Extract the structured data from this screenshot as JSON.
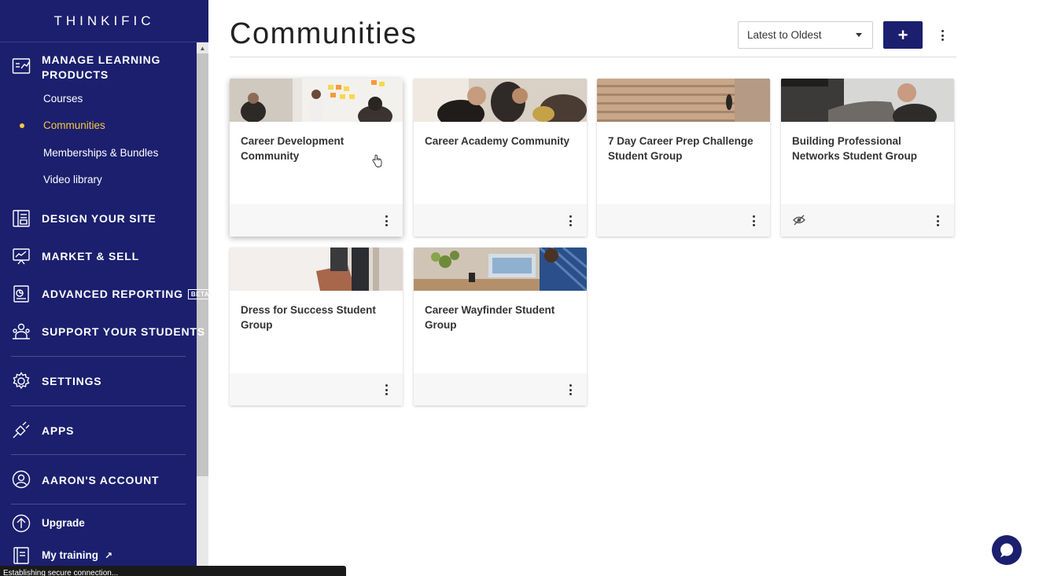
{
  "app": {
    "logo": "THINKIFIC"
  },
  "sidebar": {
    "sections": [
      {
        "title_line1": "MANAGE LEARNING",
        "title_line2": "PRODUCTS",
        "icon": "learning-products-icon"
      },
      {
        "title": "DESIGN YOUR SITE",
        "icon": "design-site-icon"
      },
      {
        "title": "MARKET & SELL",
        "icon": "market-sell-icon"
      },
      {
        "title": "ADVANCED REPORTING",
        "badge": "BETA",
        "icon": "reporting-icon"
      },
      {
        "title": "SUPPORT YOUR STUDENTS",
        "icon": "support-students-icon"
      },
      {
        "title": "SETTINGS",
        "icon": "gear-icon"
      },
      {
        "title": "APPS",
        "icon": "apps-plug-icon"
      },
      {
        "title": "AARON'S ACCOUNT",
        "icon": "user-account-icon"
      }
    ],
    "sub_items": [
      {
        "label": "Courses",
        "active": false
      },
      {
        "label": "Communities",
        "active": true
      },
      {
        "label": "Memberships & Bundles",
        "active": false
      },
      {
        "label": "Video library",
        "active": false
      }
    ],
    "upgrade": "Upgrade",
    "my_training": "My training"
  },
  "status_bar": {
    "text": "Establishing secure connection..."
  },
  "main": {
    "title": "Communities",
    "sort": {
      "selected": "Latest to Oldest"
    },
    "add_label": "+",
    "cards": [
      {
        "title": "Career Development Community",
        "hidden": false
      },
      {
        "title": "Career Academy Community",
        "hidden": false
      },
      {
        "title": "7 Day Career Prep Challenge Student Group",
        "hidden": false
      },
      {
        "title": "Building Professional Networks Student Group",
        "hidden": true
      },
      {
        "title": "Dress for Success Student Group",
        "hidden": false
      },
      {
        "title": "Career Wayfinder Student Group",
        "hidden": false
      }
    ]
  },
  "colors": {
    "sidebar_bg": "#1b1f6e",
    "active_accent": "#f5c842",
    "primary_button": "#1b1f6e"
  }
}
